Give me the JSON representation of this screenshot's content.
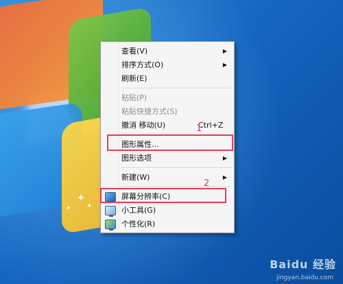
{
  "menu": {
    "items": [
      {
        "label": "查看(V)",
        "submenu": true
      },
      {
        "label": "排序方式(O)",
        "submenu": true
      },
      {
        "label": "刷新(E)"
      },
      {
        "label": "粘贴(P)",
        "disabled": true
      },
      {
        "label": "粘贴快捷方式(S)",
        "disabled": true
      },
      {
        "label": "撤消 移动(U)",
        "shortcut": "Ctrl+Z"
      },
      {
        "label": "图形属性..."
      },
      {
        "label": "图形选项",
        "submenu": true
      },
      {
        "label": "新建(W)",
        "submenu": true
      },
      {
        "label": "屏幕分辨率(C)",
        "icon": "display-icon"
      },
      {
        "label": "小工具(G)",
        "icon": "gadgets-icon"
      },
      {
        "label": "个性化(R)",
        "icon": "personalize-icon"
      }
    ]
  },
  "annotations": {
    "marker1": "1",
    "marker2": "2",
    "color": "#e23c5a"
  },
  "watermark": {
    "brand": "Baidu 经验",
    "url": "jingyan.baidu.com"
  }
}
